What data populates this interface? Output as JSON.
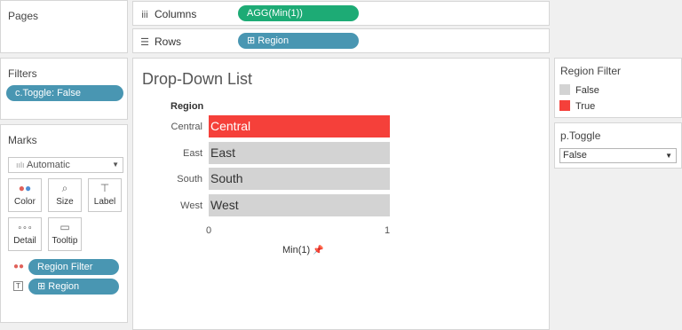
{
  "pages": {
    "title": "Pages"
  },
  "filters": {
    "title": "Filters",
    "pill": "c.Toggle: False"
  },
  "marks": {
    "title": "Marks",
    "mark_type": "Automatic",
    "buttons": {
      "color": "Color",
      "size": "Size",
      "label": "Label",
      "detail": "Detail",
      "tooltip": "Tooltip"
    },
    "fields": [
      "Region Filter",
      "⊞ Region"
    ]
  },
  "shelves": {
    "columns_label": "Columns",
    "columns_pill": "AGG(Min(1))",
    "rows_label": "Rows",
    "rows_pill": "⊞ Region"
  },
  "view": {
    "title": "Drop-Down List"
  },
  "chart_data": {
    "type": "bar",
    "orientation": "horizontal",
    "row_header": "Region",
    "categories": [
      "Central",
      "East",
      "South",
      "West"
    ],
    "values": [
      1,
      1,
      1,
      1
    ],
    "color_field": [
      "True",
      "False",
      "False",
      "False"
    ],
    "xlabel": "Min(1)",
    "xticks": [
      "0",
      "1"
    ],
    "xlim": [
      0,
      1
    ]
  },
  "legend": {
    "title": "Region Filter",
    "items": [
      {
        "label": "False",
        "color": "#d3d3d3"
      },
      {
        "label": "True",
        "color": "#f5403a"
      }
    ]
  },
  "parameter": {
    "title": "p.Toggle",
    "value": "False"
  },
  "colors": {
    "pill_blue": "#4996b2",
    "pill_green": "#1dab75",
    "highlight": "#f5403a",
    "bar_default": "#d3d3d3"
  }
}
